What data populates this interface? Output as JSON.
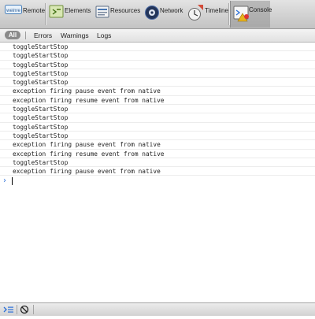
{
  "toolbar": {
    "items": [
      {
        "label": "Remote",
        "icon": "weinre-remote-icon"
      },
      {
        "label": "Elements",
        "icon": "elements-icon"
      },
      {
        "label": "Resources",
        "icon": "resources-icon"
      },
      {
        "label": "Network",
        "icon": "network-icon"
      },
      {
        "label": "Timeline",
        "icon": "timeline-icon"
      },
      {
        "label": "Console",
        "icon": "console-icon",
        "selected": true
      }
    ],
    "remote_logo_text": "weinre"
  },
  "filters": {
    "all": "All",
    "errors": "Errors",
    "warnings": "Warnings",
    "logs": "Logs"
  },
  "console": {
    "messages": [
      "toggleStartStop",
      "toggleStartStop",
      "toggleStartStop",
      "toggleStartStop",
      "toggleStartStop",
      "exception firing pause event from native",
      "exception firing resume event from native",
      "toggleStartStop",
      "toggleStartStop",
      "toggleStartStop",
      "toggleStartStop",
      "exception firing pause event from native",
      "exception firing resume event from native",
      "toggleStartStop",
      "exception firing pause event from native"
    ],
    "prompt_symbol": "›",
    "input_value": ""
  },
  "statusbar": {
    "buttons": [
      {
        "icon": "show-console-icon"
      },
      {
        "icon": "clear-console-icon"
      }
    ]
  },
  "colors": {
    "prompt_blue": "#2a6fd8",
    "filter_selected_bg": "#8a8a8a"
  }
}
